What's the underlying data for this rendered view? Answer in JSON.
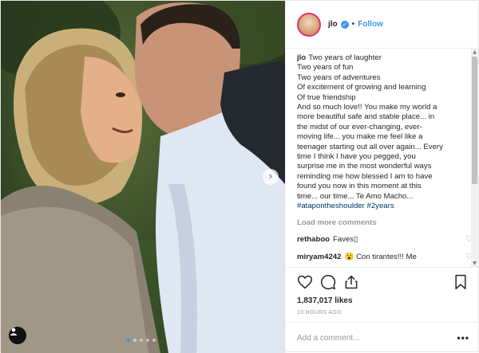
{
  "post": {
    "username": "jlo",
    "follow_separator": "•",
    "follow_label": "Follow",
    "caption_lines": [
      "Two years of laughter",
      "Two years of fun",
      "Two years of adventures",
      "Of excitement of growing and learning",
      "Of true friendship",
      "And so much love!! You make my world a",
      "more beautiful safe and stable place... in",
      "the midst of our ever-changing, ever-",
      "moving life... you make me feel like a",
      "teenager starting out all over again... Every",
      "time I think I have you pegged, you",
      "surprise me in the most wonderful ways",
      "reminding me how blessed I am to have",
      "found you now in this moment at this",
      "time... our time... Te Amo Macho..."
    ],
    "hashtags": "#atapontheshoulder #2years",
    "load_more_label": "Load more comments",
    "comments": [
      {
        "user": "rethaboo",
        "text": "Faves▯"
      },
      {
        "user": "miryam4242",
        "text": "😮 Con tirantes!!! Me"
      }
    ],
    "likes": "1,837,017 likes",
    "time": "10 HOURS AGO",
    "add_comment_placeholder": "Add a comment...",
    "more_options": "•••"
  },
  "carousel": {
    "slides": 5,
    "active_index": 0
  },
  "icons": {
    "verified": "verified-badge-icon",
    "heart": "heart-icon",
    "comment": "comment-icon",
    "share": "share-icon",
    "save": "bookmark-icon",
    "next": "chevron-right-icon",
    "user_tag": "user-tag-icon"
  },
  "colors": {
    "link_blue": "#3897f0",
    "hashtag": "#003569",
    "muted": "#999999",
    "text": "#262626"
  }
}
